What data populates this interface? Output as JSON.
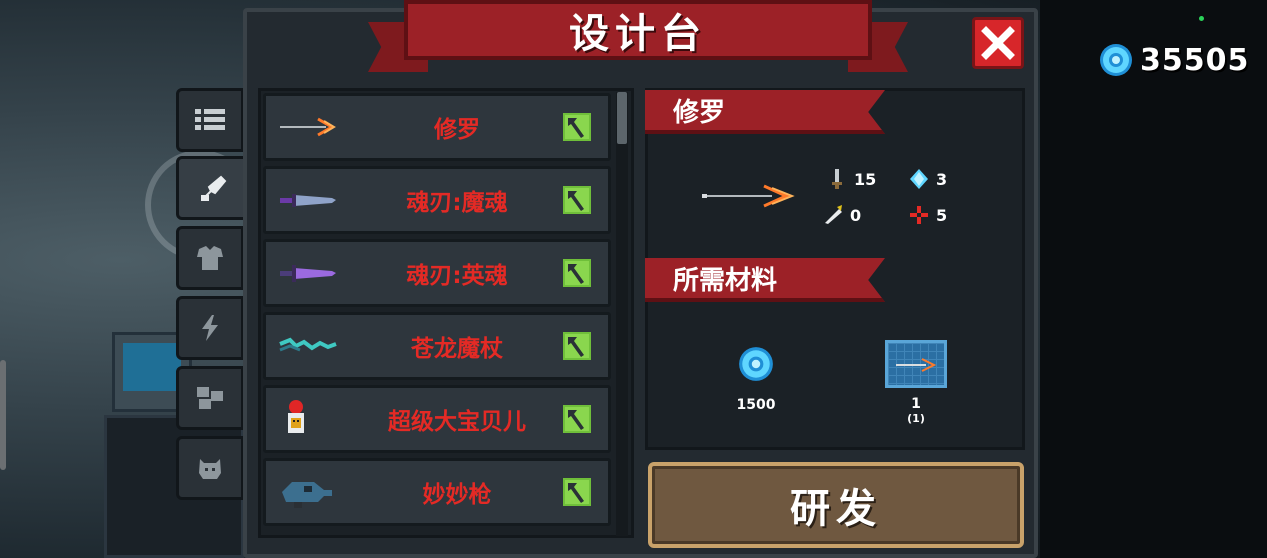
{
  "title": "设计台",
  "currency": {
    "amount": "35505",
    "icon": "gem-coin-icon"
  },
  "tabs": [
    {
      "icon": "list-icon",
      "active": false
    },
    {
      "icon": "weapon-icon",
      "active": true
    },
    {
      "icon": "armor-icon",
      "active": false
    },
    {
      "icon": "lightning-icon",
      "active": false
    },
    {
      "icon": "blocks-icon",
      "active": false
    },
    {
      "icon": "pet-icon",
      "active": false
    }
  ],
  "items": [
    {
      "name": "修罗",
      "icon": "bow-arrow-icon"
    },
    {
      "name": "魂刃:魔魂",
      "icon": "purple-blade-icon"
    },
    {
      "name": "魂刃:英魂",
      "icon": "violet-blade-icon"
    },
    {
      "name": "苍龙魔杖",
      "icon": "dragon-staff-icon"
    },
    {
      "name": "超级大宝贝儿",
      "icon": "bomb-robot-icon"
    },
    {
      "name": "妙妙枪",
      "icon": "cat-gun-icon"
    }
  ],
  "detail": {
    "name": "修罗",
    "stats": {
      "attack": "15",
      "energy": "3",
      "critical": "0",
      "accuracy": "5"
    },
    "materials_title": "所需材料",
    "materials": [
      {
        "icon": "gem-coin-icon",
        "amount": "1500"
      },
      {
        "icon": "blueprint-icon",
        "amount": "1",
        "owned": "(1)"
      }
    ]
  },
  "research_label": "研发",
  "colors": {
    "accent_red": "#9c2127",
    "item_text": "#e42a25",
    "button_gold": "#c9a26a"
  }
}
